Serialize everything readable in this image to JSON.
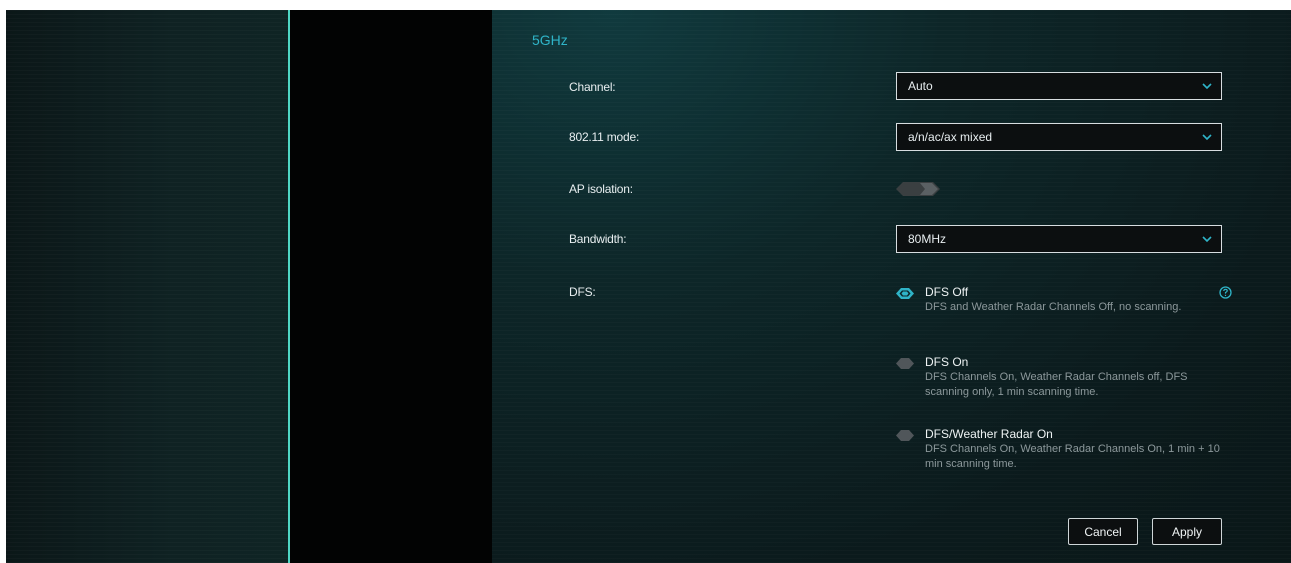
{
  "colors": {
    "accent": "#2fb4c8",
    "sidebar_edge": "#4fd6c4",
    "panel_bg": "#0d2628"
  },
  "section": {
    "title": "5GHz"
  },
  "fields": {
    "channel": {
      "label": "Channel:",
      "value": "Auto"
    },
    "mode": {
      "label": "802.11 mode:",
      "value": "a/n/ac/ax mixed"
    },
    "ap_isolation": {
      "label": "AP isolation:",
      "state": "off"
    },
    "bandwidth": {
      "label": "Bandwidth:",
      "value": "80MHz"
    },
    "dfs": {
      "label": "DFS:"
    }
  },
  "dfs_options": [
    {
      "title": "DFS Off",
      "description": "DFS and Weather Radar Channels Off, no scanning.",
      "selected": true
    },
    {
      "title": "DFS On",
      "description": "DFS Channels On, Weather Radar Channels off, DFS scanning only, 1 min scanning time.",
      "selected": false
    },
    {
      "title": "DFS/Weather Radar On",
      "description": "DFS Channels On, Weather Radar Channels On, 1 min + 10 min scanning time.",
      "selected": false
    }
  ],
  "icons": {
    "dropdown": "chevron-down-icon",
    "help": "help-circle-icon"
  },
  "buttons": {
    "cancel": "Cancel",
    "apply": "Apply"
  }
}
